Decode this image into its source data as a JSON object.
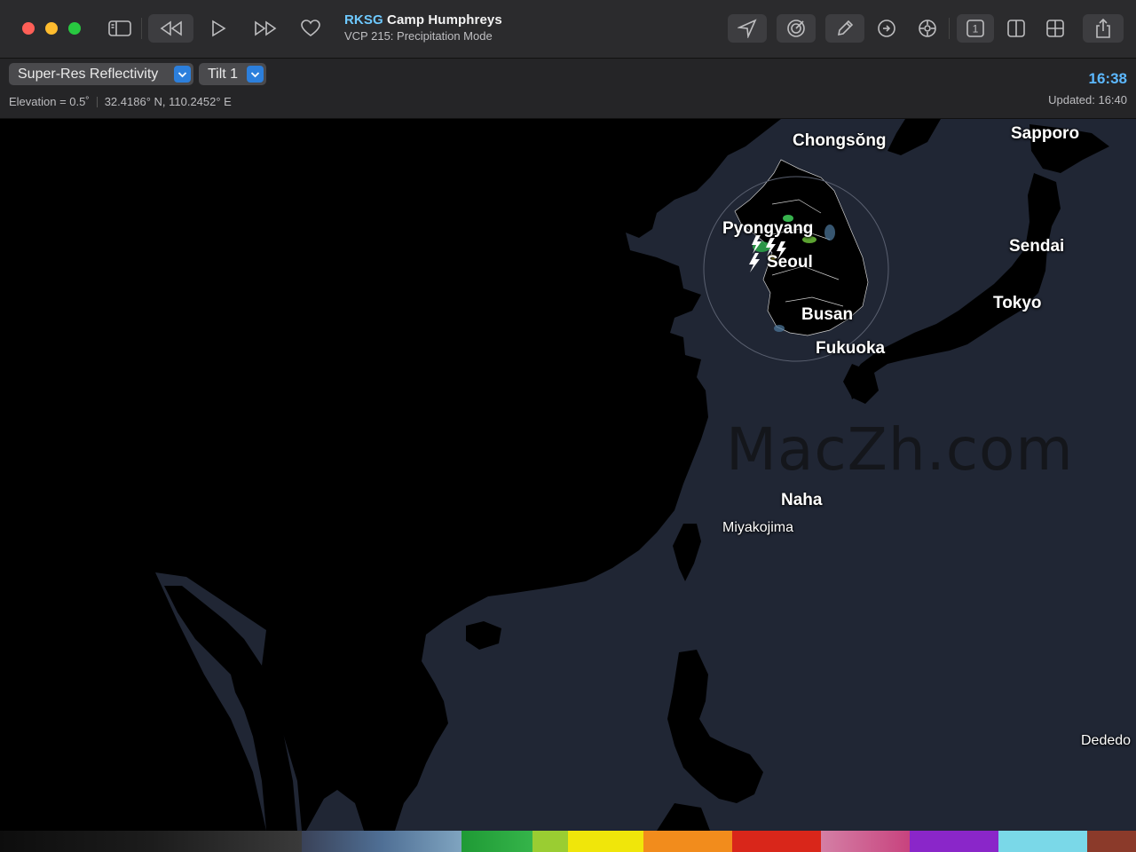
{
  "window": {
    "station_id": "RKSG",
    "station_name": "Camp Humphreys",
    "subtitle": "VCP 215: Precipitation Mode"
  },
  "toolbar": {
    "buttons": [
      "sidebar-icon",
      "rewind-icon",
      "play-icon",
      "fast-forward-icon",
      "heart-icon",
      "location-arrow-icon",
      "radar-sweep-icon",
      "pencil-icon",
      "history-icon",
      "crosshair-icon",
      "single-pane-icon",
      "split-pane-icon",
      "quad-pane-icon",
      "share-icon"
    ],
    "single_pane_label": "1"
  },
  "controls": {
    "product": "Super-Res Reflectivity",
    "tilt": "Tilt 1",
    "elevation": "Elevation = 0.5˚",
    "coordinates": "32.4186° N, 110.2452° E",
    "time": "16:38",
    "updated": "Updated: 16:40"
  },
  "map": {
    "cities": [
      "Chongsŏng",
      "Sapporo",
      "Pyongyang",
      "Seoul",
      "Sendai",
      "Tokyo",
      "Busan",
      "Fukuoka",
      "Naha",
      "Miyakojima",
      "Dededo"
    ],
    "watermark": "MacZh.com"
  },
  "colors": {
    "accent": "#2c7fdc",
    "station_id": "#6ec9ff",
    "clock": "#5cb8ff",
    "ocean": "#202634",
    "land": "#000000"
  }
}
